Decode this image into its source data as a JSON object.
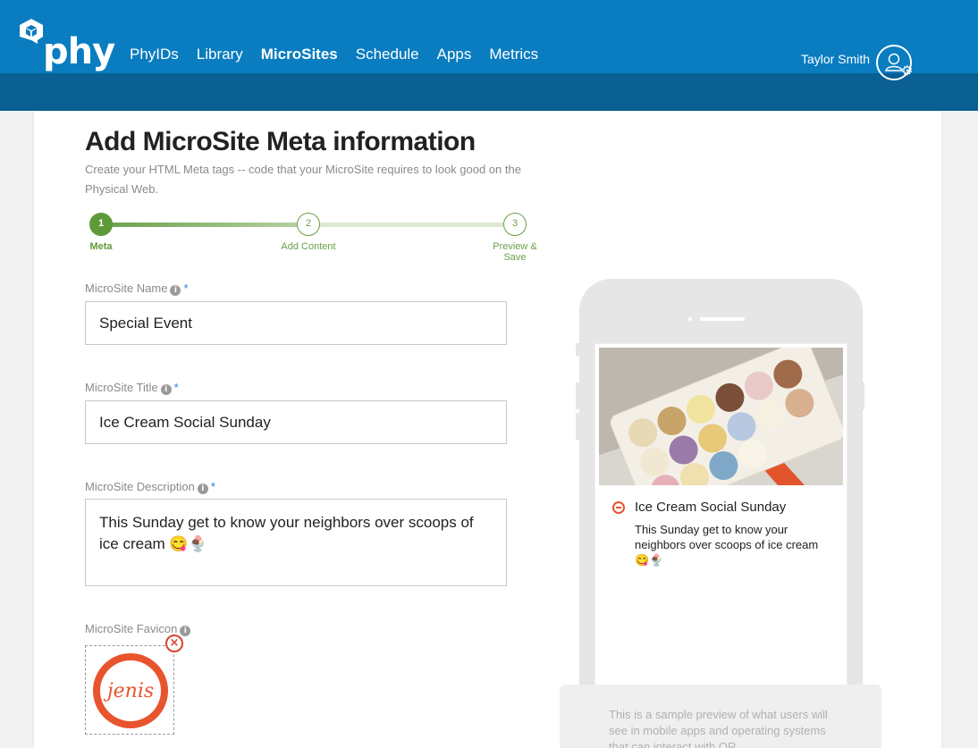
{
  "header": {
    "logo_text": "phy",
    "nav": [
      {
        "label": "PhyIDs",
        "active": false
      },
      {
        "label": "Library",
        "active": false
      },
      {
        "label": "MicroSites",
        "active": true
      },
      {
        "label": "Schedule",
        "active": false
      },
      {
        "label": "Apps",
        "active": false
      },
      {
        "label": "Metrics",
        "active": false
      }
    ],
    "user_name": "Taylor Smith",
    "colors": {
      "bar": "#0a7cc0",
      "subbar": "#0a5f93"
    }
  },
  "page": {
    "title": "Add MicroSite Meta information",
    "subtitle": "Create your HTML Meta tags -- code that your MicroSite requires to look good on the Physical Web."
  },
  "stepper": {
    "steps": [
      {
        "number": "1",
        "label": "Meta",
        "active": true
      },
      {
        "number": "2",
        "label": "Add Content",
        "active": false
      },
      {
        "number": "3",
        "label": "Preview & Save",
        "active": false
      }
    ],
    "color": "#6aa04a"
  },
  "form": {
    "name": {
      "label": "MicroSite Name",
      "required": "*",
      "value": "Special Event"
    },
    "title": {
      "label": "MicroSite Title",
      "required": "*",
      "value": "Ice Cream Social Sunday"
    },
    "description": {
      "label": "MicroSite Description",
      "required": "*",
      "value": "This Sunday get to know your neighbors over scoops of ice cream 😋🍨"
    },
    "favicon": {
      "label": "MicroSite Favicon",
      "logo_text": "jenis",
      "remove_icon": "close-circle-icon"
    }
  },
  "preview": {
    "title": "Ice Cream Social Sunday",
    "description": "This Sunday get to know your neighbors over scoops of ice cream 😋🍨",
    "note": "This is a sample preview of what users will see in mobile apps and operating systems that can interact with QR"
  }
}
